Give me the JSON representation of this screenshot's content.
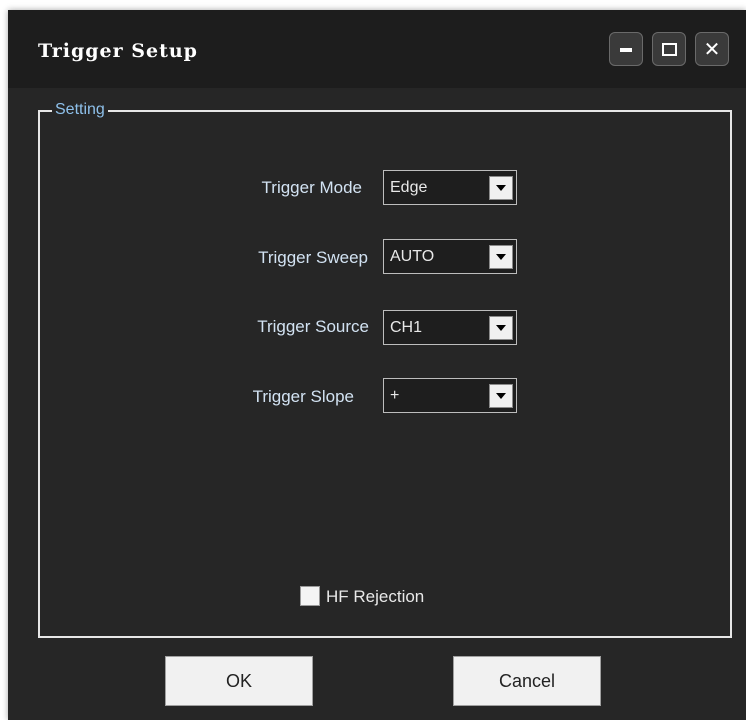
{
  "window": {
    "title": "Trigger Setup",
    "controls": [
      "minimize-icon",
      "maximize-icon",
      "close-icon"
    ],
    "close_glyph": "✕"
  },
  "group": {
    "label": "Setting"
  },
  "fields": [
    {
      "label": "Trigger Mode",
      "value": "Edge"
    },
    {
      "label": "Trigger Sweep",
      "value": "AUTO"
    },
    {
      "label": "Trigger Source",
      "value": "CH1"
    },
    {
      "label": "Trigger Slope",
      "value": "+"
    }
  ],
  "hf_rejection": {
    "label": "HF Rejection",
    "checked": false
  },
  "buttons": {
    "ok": "OK",
    "cancel": "Cancel"
  },
  "colors": {
    "window_bg": "#262626",
    "group_label": "#8ec0ea",
    "field_label": "#d2e2f2",
    "button_bg": "#f1f1f1"
  }
}
